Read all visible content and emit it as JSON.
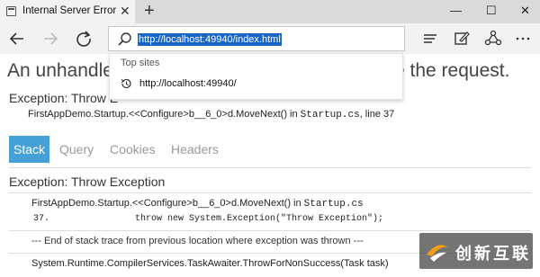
{
  "browser": {
    "tab_title": "Internal Server Error",
    "tab_close": "✕",
    "new_tab": "+",
    "window_controls": {
      "minimize": "—",
      "maximize": "☐",
      "close": "✕"
    },
    "address": "http://localhost:49940/index.html"
  },
  "autocomplete": {
    "heading": "Top sites",
    "items": [
      {
        "label": "http://localhost:49940/"
      }
    ]
  },
  "page": {
    "heading_left": "An unhandled",
    "heading_right": "e the request.",
    "exception_title": "Exception: Throw E",
    "exception_location_prefix": "FirstAppDemo.Startup.<<Configure>b__6_0>d.MoveNext() in ",
    "exception_file": "Startup.cs",
    "exception_line": ", line 37",
    "tabs": [
      {
        "label": "Stack",
        "active": true
      },
      {
        "label": "Query",
        "active": false
      },
      {
        "label": "Cookies",
        "active": false
      },
      {
        "label": "Headers",
        "active": false
      }
    ],
    "stack_title": "Exception: Throw Exception",
    "frame1_prefix": "FirstAppDemo.Startup.<<Configure>b__6_0>d.MoveNext() in ",
    "frame1_file": "Startup.cs",
    "code_line_number": "37.",
    "code_line": "throw new System.Exception(\"Throw Exception\");",
    "separator": "--- End of stack trace from previous location where exception was thrown ---",
    "frame2": "System.Runtime.CompilerServices.TaskAwaiter.ThrowForNonSuccess(Task task)"
  },
  "watermark": {
    "text": "创新互联"
  },
  "colors": {
    "active_tab": "#44a0d6",
    "selection": "#1a66c6"
  },
  "icons": [
    "back-arrow-icon",
    "forward-arrow-icon",
    "refresh-icon",
    "search-icon",
    "reading-list-icon",
    "web-note-icon",
    "share-icon",
    "more-icon",
    "history-icon"
  ]
}
